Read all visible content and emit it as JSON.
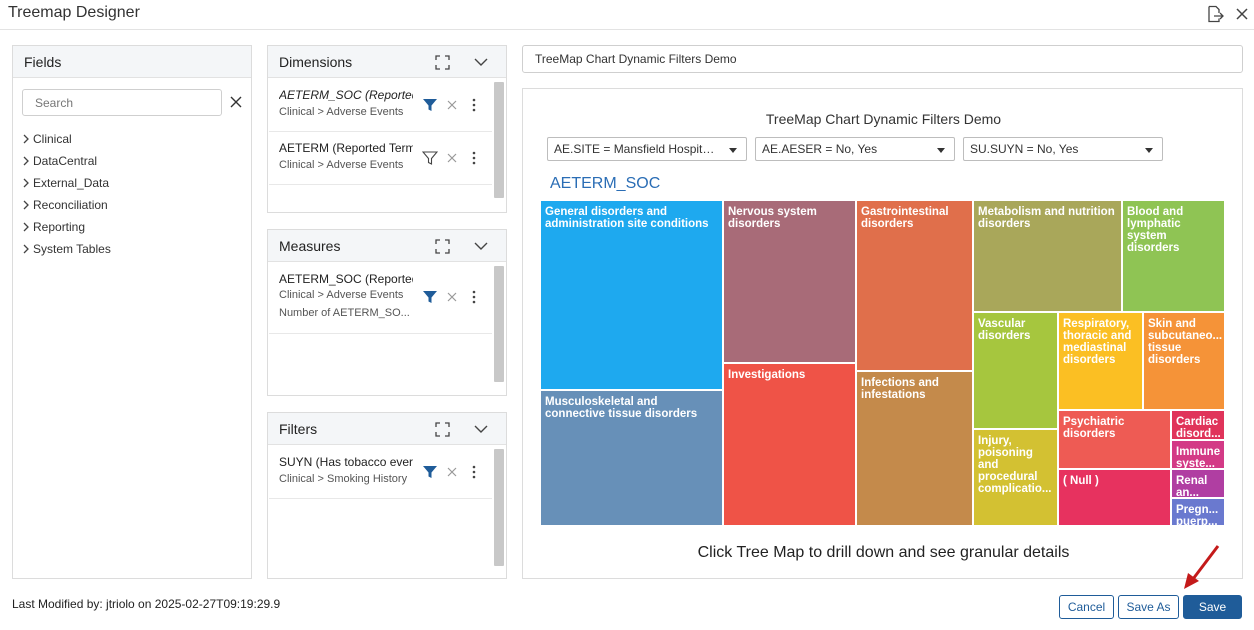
{
  "window": {
    "title": "Treemap Designer"
  },
  "fields": {
    "header": "Fields",
    "search_placeholder": "Search",
    "items": [
      "Clinical",
      "DataCentral",
      "External_Data",
      "Reconciliation",
      "Reporting",
      "System Tables"
    ]
  },
  "dimensions": {
    "header": "Dimensions",
    "cards": [
      {
        "name": "AETERM_SOC (Reported",
        "path": "Clinical > Adverse Events",
        "filter_active": true
      },
      {
        "name": "AETERM (Reported Term",
        "path": "Clinical > Adverse Events",
        "filter_active": false
      }
    ]
  },
  "measures": {
    "header": "Measures",
    "cards": [
      {
        "name": "AETERM_SOC (Reported",
        "path": "Clinical > Adverse Events",
        "sub": "Number of AETERM_SO...",
        "filter_active": true
      }
    ]
  },
  "filters": {
    "header": "Filters",
    "cards": [
      {
        "name": "SUYN (Has tobacco ever",
        "path": "Clinical > Smoking History",
        "filter_active": true
      }
    ]
  },
  "chart": {
    "title_input": "TreeMap Chart Dynamic Filters Demo",
    "title": "TreeMap Chart Dynamic Filters Demo",
    "dropdowns": [
      "AE.SITE = Mansfield Hospita...",
      "AE.AESER = No, Yes",
      "SU.SUYN = No, Yes"
    ],
    "level_label": "AETERM_SOC",
    "footer": "Click Tree Map to drill down and see granular details",
    "tiles": [
      {
        "label": "General disorders and administration site conditions",
        "color": "#1ea9ef"
      },
      {
        "label": "Musculoskeletal and connective tissue disorders",
        "color": "#6790b8"
      },
      {
        "label": "Nervous system disorders",
        "color": "#a86b78"
      },
      {
        "label": "Investigations",
        "color": "#ef5347"
      },
      {
        "label": "Gastrointestinal disorders",
        "color": "#e06f4b"
      },
      {
        "label": "Infections and infestations",
        "color": "#c48a4b"
      },
      {
        "label": "Metabolism and nutrition disorders",
        "color": "#a9a75a"
      },
      {
        "label": "Blood and lymphatic system disorders",
        "color": "#8fc454"
      },
      {
        "label": "Vascular disorders",
        "color": "#a6c63e"
      },
      {
        "label": "Respiratory, thoracic and mediastinal disorders",
        "color": "#fbbf23"
      },
      {
        "label": "Skin and subcutaneo... tissue disorders",
        "color": "#f59338"
      },
      {
        "label": "Injury, poisoning and procedural complicatio...",
        "color": "#d3c132"
      },
      {
        "label": "Psychiatric disorders",
        "color": "#ee5b54"
      },
      {
        "label": "Cardiac disord...",
        "color": "#e0345a"
      },
      {
        "label": "( Null )",
        "color": "#e7325f"
      },
      {
        "label": "Immune syste...",
        "color": "#d33a86"
      },
      {
        "label": "Renal an...",
        "color": "#b03ea2"
      },
      {
        "label": "Pregn... puerp...",
        "color": "#6a79cf"
      }
    ]
  },
  "footer": {
    "last_modified": "Last Modified by: jtriolo on 2025-02-27T09:19:29.9",
    "cancel": "Cancel",
    "save_as": "Save As",
    "save": "Save"
  }
}
